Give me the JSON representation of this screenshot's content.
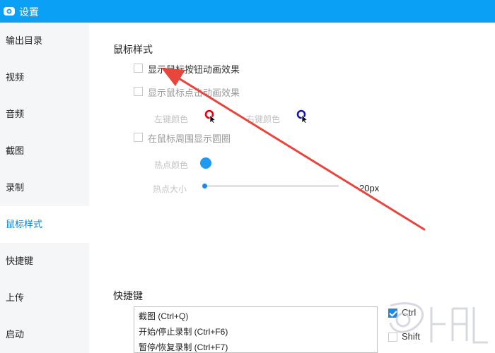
{
  "window": {
    "title": "设置",
    "accent_color": "#0aa0f5"
  },
  "sidebar": {
    "items": [
      {
        "label": "输出目录"
      },
      {
        "label": "视频"
      },
      {
        "label": "音频"
      },
      {
        "label": "截图"
      },
      {
        "label": "录制"
      },
      {
        "label": "鼠标样式",
        "active": true
      },
      {
        "label": "快捷键"
      },
      {
        "label": "上传"
      },
      {
        "label": "启动"
      }
    ]
  },
  "mouse_style": {
    "title": "鼠标样式",
    "show_click_animation": {
      "label": "显示鼠标按钮动画效果",
      "checked": false
    },
    "show_point_animation": {
      "label": "显示鼠标点击动画效果",
      "checked": false
    },
    "left_color_label": "左键颜色",
    "left_color": "#e60012",
    "right_color_label": "右键颜色",
    "right_color": "#1a1aa6",
    "show_circle": {
      "label": "在鼠标周围显示圆圈",
      "checked": false
    },
    "hot_color_label": "热点颜色",
    "hot_color": "#1e9bf0",
    "hot_size_label": "热点大小",
    "hot_size_value": "20px",
    "hot_size_fraction": 0.0
  },
  "hotkeys": {
    "title": "快捷键",
    "list": [
      "截图 (Ctrl+Q)",
      "开始/停止录制 (Ctrl+F6)",
      "暂停/恢复录制 (Ctrl+F7)"
    ],
    "modifiers": [
      {
        "label": "Ctrl",
        "checked": true
      },
      {
        "label": "Shift",
        "checked": false
      }
    ]
  },
  "annotation": {
    "arrow_color": "#e8453c"
  }
}
